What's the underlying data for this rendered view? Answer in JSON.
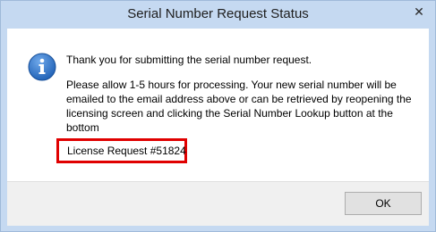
{
  "dialog": {
    "title": "Serial Number Request Status",
    "close_symbol": "✕",
    "icon": "info-icon",
    "message_line1": "Thank you for submitting the serial number request.",
    "message_line2": "Please allow 1-5 hours for processing. Your new serial number will be emailed to the email address above or can be retrieved by reopening the licensing screen and clicking the Serial Number Lookup button at the bottom",
    "license_request": "License Request #51824",
    "ok_label": "OK"
  },
  "colors": {
    "titlebar": "#c5d9f1",
    "highlight_border": "#e00000",
    "icon_blue": "#1d5fb4"
  }
}
